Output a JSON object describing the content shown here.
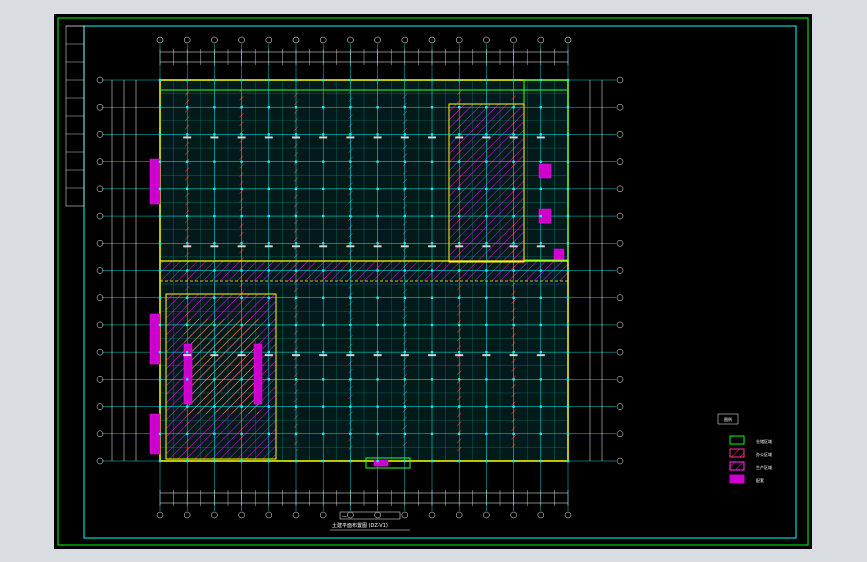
{
  "viewport": {
    "background": "#d9dde2",
    "paper": "#000000"
  },
  "colors": {
    "frame": "#00ff00",
    "inner_frame": "#00ffff",
    "grid": "#00ffff",
    "wall": "#ffff00",
    "outline": "#33ff33",
    "hatch_red": "#ff3333",
    "hatch_magenta": "#ff00ff",
    "hatch_orange": "#ff9933",
    "text": "#ffffff",
    "dim": "#ffffff"
  },
  "drawing": {
    "title_line1": "—",
    "title_line2": "土建平面布置图 (DZ-V1)",
    "scale_box": "1:100"
  },
  "legend": {
    "title": "图例",
    "items": [
      {
        "label": "仓储区域",
        "style": "outline",
        "color": "#00ff00"
      },
      {
        "label": "办公区域",
        "style": "hatch",
        "color": "#ff3399"
      },
      {
        "label": "生产区域",
        "style": "hatch",
        "color": "#ff33ff"
      },
      {
        "label": "配套",
        "style": "fill",
        "color": "#cc00cc"
      }
    ]
  }
}
